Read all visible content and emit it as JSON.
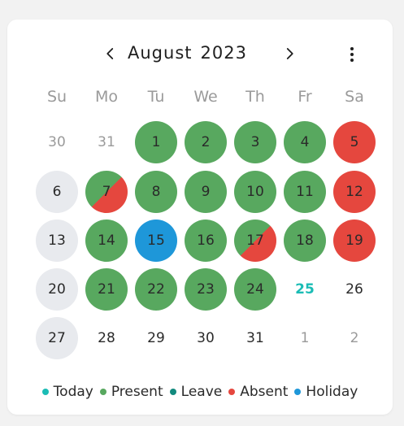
{
  "calendar": {
    "month": "August",
    "year": "2023",
    "weekdays": [
      "Su",
      "Mo",
      "Tu",
      "We",
      "Th",
      "Fr",
      "Sa"
    ],
    "weeks": [
      [
        {
          "label": "30",
          "status": "outside"
        },
        {
          "label": "31",
          "status": "outside"
        },
        {
          "label": "1",
          "status": "present"
        },
        {
          "label": "2",
          "status": "present"
        },
        {
          "label": "3",
          "status": "present"
        },
        {
          "label": "4",
          "status": "present"
        },
        {
          "label": "5",
          "status": "absent"
        }
      ],
      [
        {
          "label": "6",
          "status": "weekend"
        },
        {
          "label": "7",
          "status": "present-absent"
        },
        {
          "label": "8",
          "status": "present"
        },
        {
          "label": "9",
          "status": "present"
        },
        {
          "label": "10",
          "status": "present"
        },
        {
          "label": "11",
          "status": "present"
        },
        {
          "label": "12",
          "status": "absent"
        }
      ],
      [
        {
          "label": "13",
          "status": "weekend"
        },
        {
          "label": "14",
          "status": "present"
        },
        {
          "label": "15",
          "status": "holiday"
        },
        {
          "label": "16",
          "status": "present"
        },
        {
          "label": "17",
          "status": "present-absent"
        },
        {
          "label": "18",
          "status": "present"
        },
        {
          "label": "19",
          "status": "absent"
        }
      ],
      [
        {
          "label": "20",
          "status": "weekend"
        },
        {
          "label": "21",
          "status": "present"
        },
        {
          "label": "22",
          "status": "present"
        },
        {
          "label": "23",
          "status": "present"
        },
        {
          "label": "24",
          "status": "present"
        },
        {
          "label": "25",
          "status": "today"
        },
        {
          "label": "26",
          "status": "none"
        }
      ],
      [
        {
          "label": "27",
          "status": "weekend"
        },
        {
          "label": "28",
          "status": "none"
        },
        {
          "label": "29",
          "status": "none"
        },
        {
          "label": "30",
          "status": "none"
        },
        {
          "label": "31",
          "status": "none"
        },
        {
          "label": "1",
          "status": "outside"
        },
        {
          "label": "2",
          "status": "outside"
        }
      ]
    ]
  },
  "legend": [
    {
      "label": "Today",
      "color": "#1bbcb5"
    },
    {
      "label": "Present",
      "color": "#58a85f"
    },
    {
      "label": "Leave",
      "color": "#138a7e"
    },
    {
      "label": "Absent",
      "color": "#e5473e"
    },
    {
      "label": "Holiday",
      "color": "#1e97d9"
    }
  ],
  "icons": {
    "prev": "chevron-left-icon",
    "next": "chevron-right-icon",
    "more": "more-vertical-icon"
  }
}
